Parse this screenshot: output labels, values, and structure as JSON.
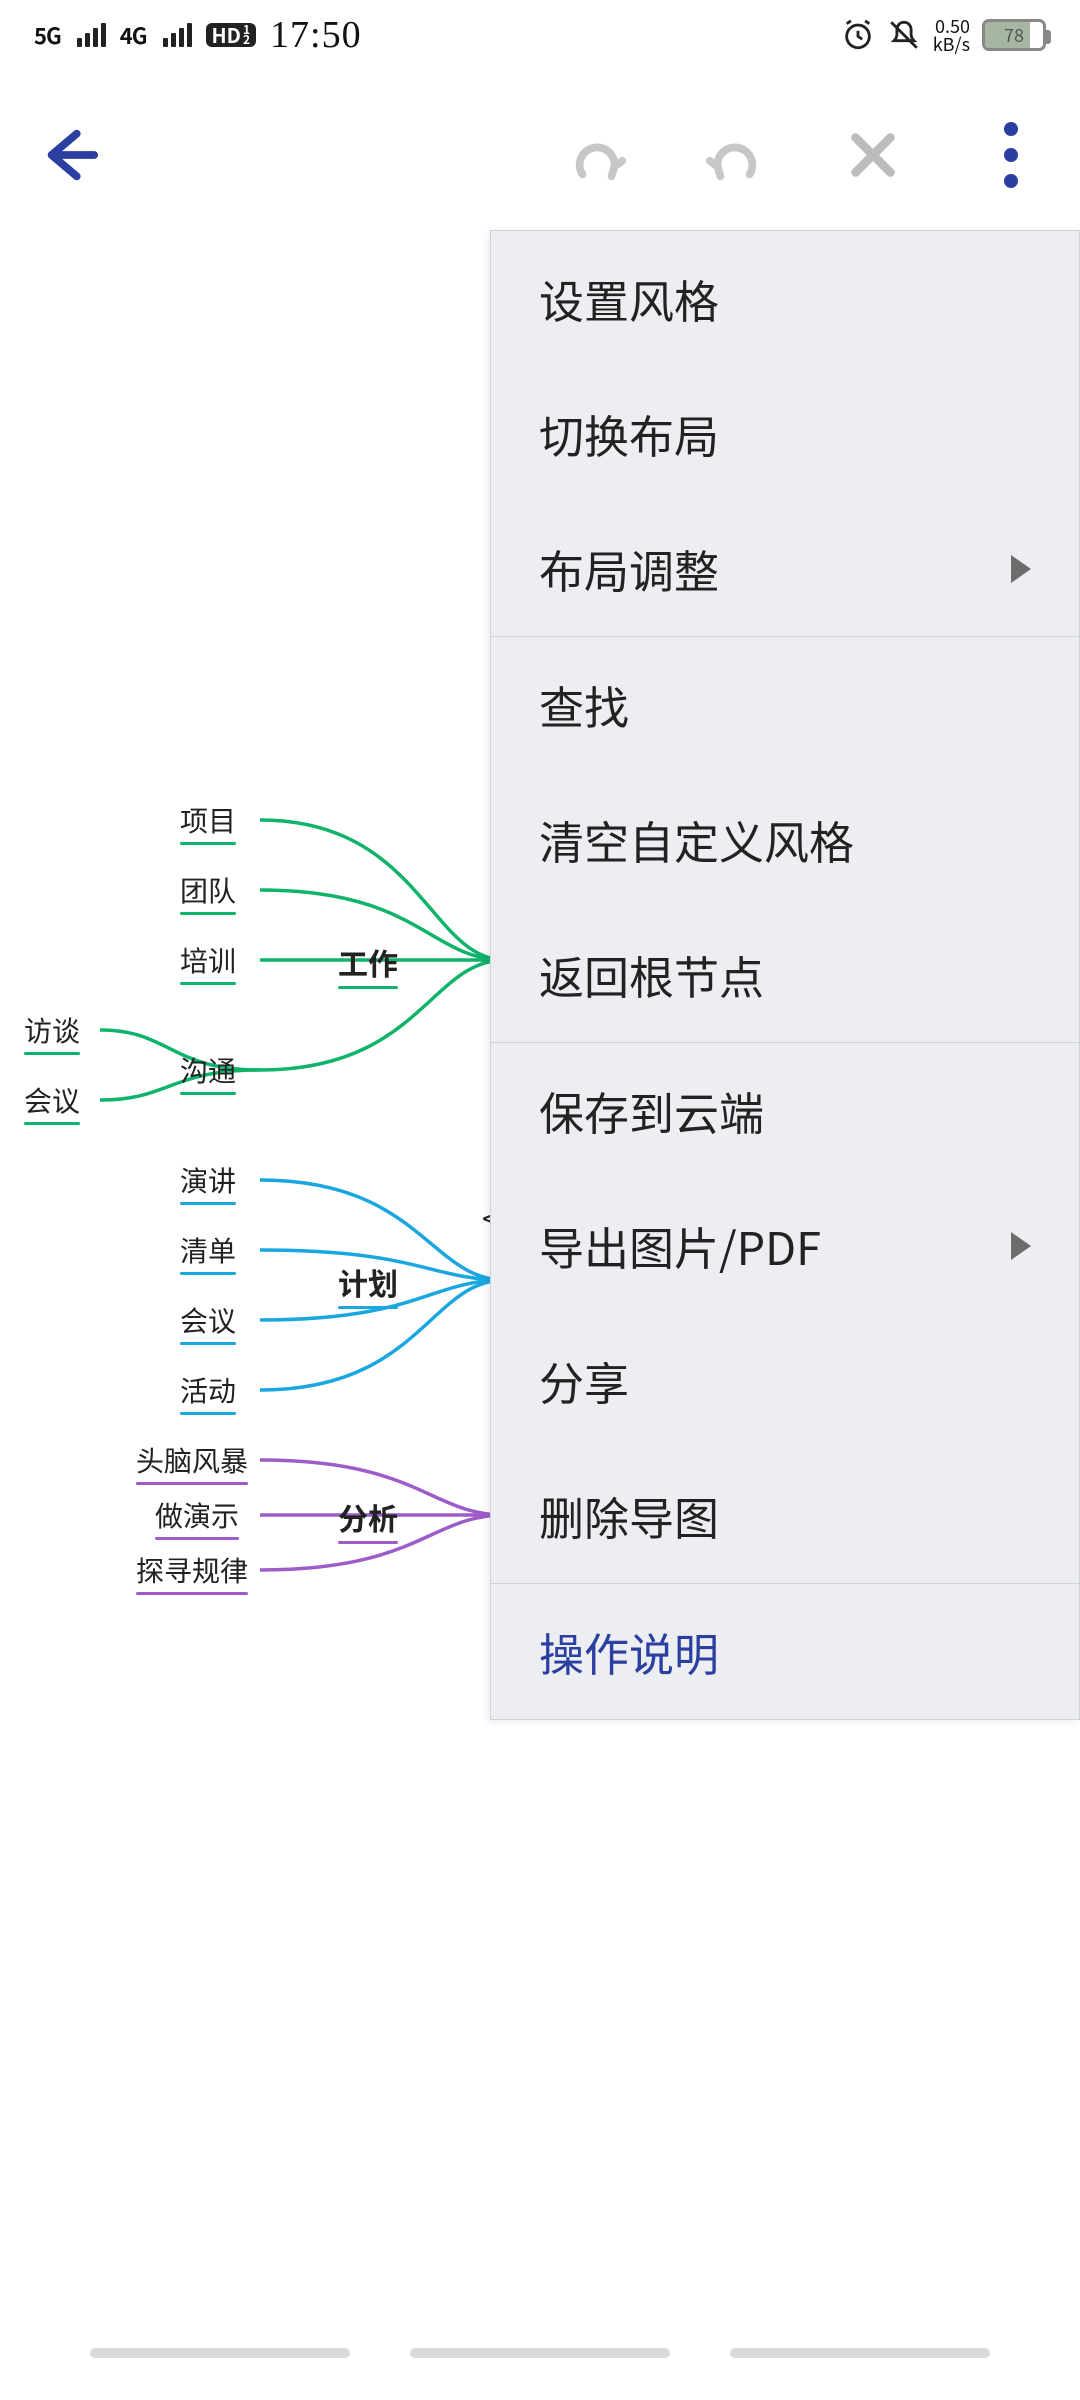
{
  "status": {
    "net1_label": "5G",
    "net2_label": "4G",
    "hd_label": "HD",
    "hd_sub1": "1",
    "hd_sub2": "2",
    "clock": "17:50",
    "data_rate_top": "0.50",
    "data_rate_bottom": "kB/s",
    "battery_pct": "78",
    "battery_fill": 78
  },
  "mindmap": {
    "branch_work": {
      "label": "工作",
      "children": [
        "项目",
        "团队",
        "培训",
        "沟通"
      ],
      "comm_children": [
        "访谈",
        "会议"
      ]
    },
    "branch_plan": {
      "label": "计划",
      "children": [
        "演讲",
        "清单",
        "会议",
        "活动"
      ]
    },
    "branch_analy": {
      "label": "分析",
      "children": [
        "头脑风暴",
        "做演示",
        "探寻规律"
      ]
    },
    "colors": {
      "work": "#0fb36a",
      "plan": "#1aa7e0",
      "analy": "#9e5cc9",
      "comm": "#0fb36a"
    }
  },
  "menu": {
    "groups": [
      [
        {
          "id": "style",
          "label": "设置风格"
        },
        {
          "id": "layout",
          "label": "切换布局"
        },
        {
          "id": "adjust",
          "label": "布局调整",
          "arrow": true
        }
      ],
      [
        {
          "id": "find",
          "label": "查找"
        },
        {
          "id": "clear",
          "label": "清空自定义风格"
        },
        {
          "id": "root",
          "label": "返回根节点"
        }
      ],
      [
        {
          "id": "cloud",
          "label": "保存到云端"
        },
        {
          "id": "export",
          "label": "导出图片/PDF",
          "arrow": true
        },
        {
          "id": "share",
          "label": "分享"
        },
        {
          "id": "delete",
          "label": "删除导图"
        }
      ],
      [
        {
          "id": "help",
          "label": "操作说明",
          "special": true
        }
      ]
    ]
  }
}
